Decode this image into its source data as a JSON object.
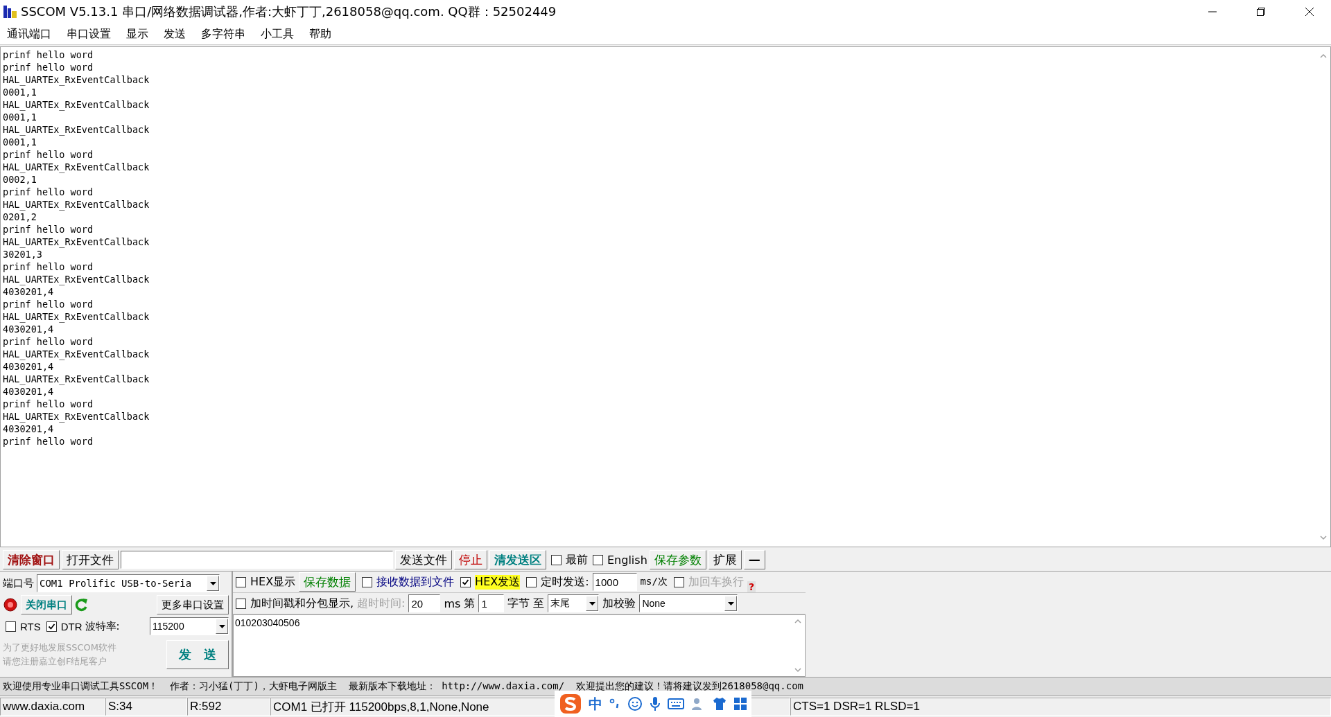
{
  "window": {
    "title": "SSCOM V5.13.1 串口/网络数据调试器,作者:大虾丁丁,2618058@qq.com. QQ群：52502449"
  },
  "menu": [
    "通讯端口",
    "串口设置",
    "显示",
    "发送",
    "多字符串",
    "小工具",
    "帮助"
  ],
  "receive_log": {
    "lines": [
      "prinf hello word",
      "prinf hello word",
      "HAL_UARTEx_RxEventCallback",
      "0001,1",
      "HAL_UARTEx_RxEventCallback",
      "0001,1",
      "HAL_UARTEx_RxEventCallback",
      "0001,1",
      "prinf hello word",
      "HAL_UARTEx_RxEventCallback",
      "0002,1",
      "prinf hello word",
      "HAL_UARTEx_RxEventCallback",
      "0201,2",
      "prinf hello word",
      "HAL_UARTEx_RxEventCallback",
      "30201,3",
      "prinf hello word",
      "HAL_UARTEx_RxEventCallback",
      "4030201,4",
      "prinf hello word",
      "HAL_UARTEx_RxEventCallback",
      "4030201,4",
      "prinf hello word",
      "HAL_UARTEx_RxEventCallback",
      "4030201,4",
      "HAL_UARTEx_RxEventCallback",
      "4030201,4",
      "prinf hello word",
      "HAL_UARTEx_RxEventCallback",
      "4030201,4",
      "prinf hello word"
    ]
  },
  "toolbar": [
    {
      "kind": "button",
      "label": "清除窗口",
      "color": "#a01010",
      "bold": true
    },
    {
      "kind": "button",
      "label": "打开文件",
      "color": "#000000",
      "bold": false
    },
    {
      "kind": "field"
    },
    {
      "kind": "button",
      "label": "发送文件",
      "color": "#000000",
      "bold": false
    },
    {
      "kind": "button",
      "label": "停止",
      "color": "#c00000",
      "bold": false
    },
    {
      "kind": "button",
      "label": "清发送区",
      "color": "#008080",
      "bold": true
    },
    {
      "kind": "checkbox",
      "label": "最前",
      "checked": false
    },
    {
      "kind": "checkbox",
      "label": "English",
      "checked": false
    },
    {
      "kind": "button",
      "label": "保存参数",
      "color": "#008000",
      "bold": false
    },
    {
      "kind": "button",
      "label": "扩展",
      "color": "#000000",
      "bold": false
    },
    {
      "kind": "button",
      "label": "—",
      "color": "#000000",
      "bold": true
    }
  ],
  "port": {
    "label": "端口号",
    "value": "COM1 Prolific USB-to-Seria",
    "close_button": "关闭串口",
    "port_open": true,
    "more_button": "更多串口设置",
    "rts": {
      "label": "RTS",
      "checked": false
    },
    "dtr": {
      "label": "DTR",
      "checked": true
    },
    "baud_label": "波特率:",
    "baud": "115200",
    "promo": [
      "为了更好地发展SSCOM软件",
      "请您注册嘉立创F结尾客户"
    ],
    "send_button": "发　送"
  },
  "options_row1": [
    {
      "kind": "checkbox",
      "label": "HEX显示",
      "checked": false,
      "disabled": false,
      "highlight": false
    },
    {
      "kind": "button",
      "label": "保存数据",
      "color": "#008000"
    },
    {
      "kind": "checkbox",
      "label": "接收数据到文件",
      "checked": false,
      "disabled": false,
      "highlight": false,
      "color": "#000080"
    },
    {
      "kind": "checkbox",
      "label": "HEX发送",
      "checked": true,
      "disabled": false,
      "highlight": true
    },
    {
      "kind": "checkbox",
      "label": "定时发送:",
      "checked": false,
      "disabled": false,
      "highlight": false
    },
    {
      "kind": "field",
      "value": "1000"
    },
    {
      "kind": "text",
      "label": "ms/次"
    },
    {
      "kind": "checkbox",
      "label": "加回车换行",
      "checked": false,
      "disabled": true,
      "highlight": false
    },
    {
      "kind": "help",
      "label": "?"
    }
  ],
  "options_row2": [
    {
      "kind": "checkbox",
      "label": "加时间戳和分包显示,",
      "checked": false
    },
    {
      "kind": "text",
      "label": "超时时间:",
      "disabled": true
    },
    {
      "kind": "field",
      "value": "20"
    },
    {
      "kind": "text",
      "label": "ms",
      "disabled": false
    },
    {
      "kind": "text",
      "label": "第",
      "disabled": false
    },
    {
      "kind": "field",
      "value": "1"
    },
    {
      "kind": "text",
      "label": "字节",
      "disabled": false
    },
    {
      "kind": "text",
      "label": "至",
      "disabled": false
    },
    {
      "kind": "select",
      "value": "末尾"
    },
    {
      "kind": "text",
      "label": "加校验",
      "disabled": false
    },
    {
      "kind": "select",
      "value": "None"
    }
  ],
  "send_text": "010203040506",
  "ticker": "欢迎使用专业串口调试工具SSCOM！  作者：习小猛(丁丁)，大虾电子网版主  最新版本下载地址： http://www.daxia.com/  欢迎提出您的建议！请将建议发到2618058@qq.com",
  "status_bar": [
    "www.daxia.com",
    "S:34",
    "R:592",
    "COM1 已打开  115200bps,8,1,None,None",
    "CTS=1 DSR=1 RLSD=1"
  ],
  "ime_bar": {
    "label": "中"
  }
}
